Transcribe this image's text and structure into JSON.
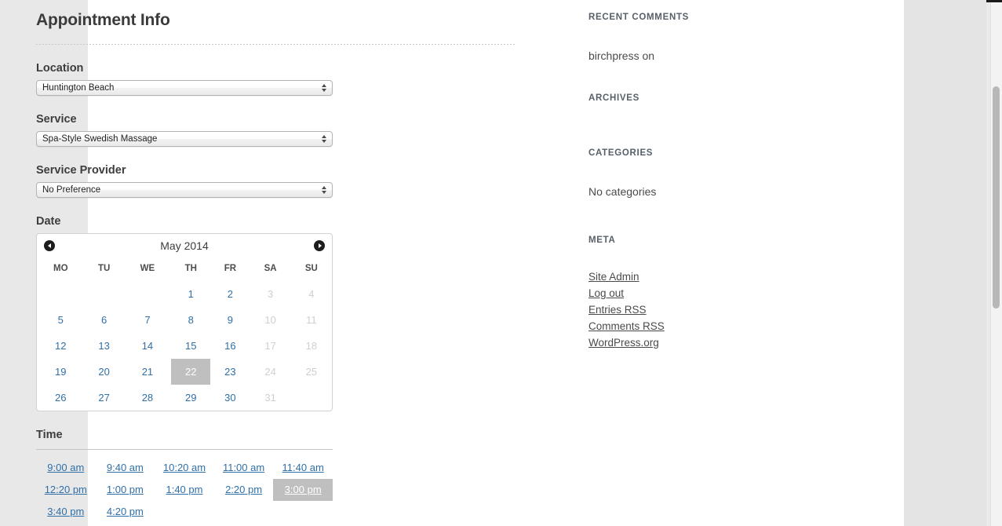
{
  "page": {
    "title": "Appointment Info"
  },
  "form": {
    "location": {
      "label": "Location",
      "value": "Huntington Beach",
      "options": [
        "Huntington Beach"
      ]
    },
    "service": {
      "label": "Service",
      "value": "Spa-Style Swedish Massage",
      "options": [
        "Spa-Style Swedish Massage"
      ]
    },
    "provider": {
      "label": "Service Provider",
      "value": "No Preference",
      "options": [
        "No Preference"
      ]
    },
    "date": {
      "label": "Date"
    },
    "time": {
      "label": "Time"
    }
  },
  "calendar": {
    "month_title": "May 2014",
    "prev_icon": "chevron-left-icon",
    "next_icon": "chevron-right-icon",
    "weekdays": [
      "MO",
      "TU",
      "WE",
      "TH",
      "FR",
      "SA",
      "SU"
    ],
    "selected_day": "22",
    "weeks": [
      [
        {
          "label": "",
          "state": "empty"
        },
        {
          "label": "",
          "state": "empty"
        },
        {
          "label": "",
          "state": "empty"
        },
        {
          "label": "1",
          "state": "avail"
        },
        {
          "label": "2",
          "state": "avail"
        },
        {
          "label": "3",
          "state": "off"
        },
        {
          "label": "4",
          "state": "off"
        }
      ],
      [
        {
          "label": "5",
          "state": "avail"
        },
        {
          "label": "6",
          "state": "avail"
        },
        {
          "label": "7",
          "state": "avail"
        },
        {
          "label": "8",
          "state": "avail"
        },
        {
          "label": "9",
          "state": "avail"
        },
        {
          "label": "10",
          "state": "off"
        },
        {
          "label": "11",
          "state": "off"
        }
      ],
      [
        {
          "label": "12",
          "state": "avail"
        },
        {
          "label": "13",
          "state": "avail"
        },
        {
          "label": "14",
          "state": "avail"
        },
        {
          "label": "15",
          "state": "avail"
        },
        {
          "label": "16",
          "state": "avail"
        },
        {
          "label": "17",
          "state": "off"
        },
        {
          "label": "18",
          "state": "off"
        }
      ],
      [
        {
          "label": "19",
          "state": "avail"
        },
        {
          "label": "20",
          "state": "avail"
        },
        {
          "label": "21",
          "state": "avail"
        },
        {
          "label": "22",
          "state": "sel"
        },
        {
          "label": "23",
          "state": "avail"
        },
        {
          "label": "24",
          "state": "off"
        },
        {
          "label": "25",
          "state": "off"
        }
      ],
      [
        {
          "label": "26",
          "state": "avail"
        },
        {
          "label": "27",
          "state": "avail"
        },
        {
          "label": "28",
          "state": "avail"
        },
        {
          "label": "29",
          "state": "avail"
        },
        {
          "label": "30",
          "state": "avail"
        },
        {
          "label": "31",
          "state": "off"
        },
        {
          "label": "",
          "state": "empty"
        }
      ]
    ]
  },
  "time_slots": {
    "selected": "3:00 pm",
    "slots": [
      {
        "label": "9:00 am",
        "state": "avail"
      },
      {
        "label": "9:40 am",
        "state": "avail"
      },
      {
        "label": "10:20 am",
        "state": "avail"
      },
      {
        "label": "11:00 am",
        "state": "avail"
      },
      {
        "label": "11:40 am",
        "state": "avail"
      },
      {
        "label": "12:20 pm",
        "state": "avail"
      },
      {
        "label": "1:00 pm",
        "state": "avail"
      },
      {
        "label": "1:40 pm",
        "state": "avail"
      },
      {
        "label": "2:20 pm",
        "state": "avail"
      },
      {
        "label": "3:00 pm",
        "state": "sel"
      },
      {
        "label": "3:40 pm",
        "state": "avail"
      },
      {
        "label": "4:20 pm",
        "state": "avail"
      }
    ]
  },
  "sidebar": {
    "recent_comments": {
      "title": "RECENT COMMENTS",
      "items": [
        "birchpress on"
      ]
    },
    "archives": {
      "title": "ARCHIVES",
      "items": []
    },
    "categories": {
      "title": "CATEGORIES",
      "items": [
        "No categories"
      ]
    },
    "meta": {
      "title": "META",
      "links": [
        "Site Admin",
        "Log out",
        "Entries RSS",
        "Comments RSS",
        "WordPress.org"
      ]
    }
  },
  "colors": {
    "link": "#2f6fa8",
    "selected_bg": "#bfbfbf",
    "page_bg": "#e8e8e8",
    "heading": "#3b3b3b"
  }
}
